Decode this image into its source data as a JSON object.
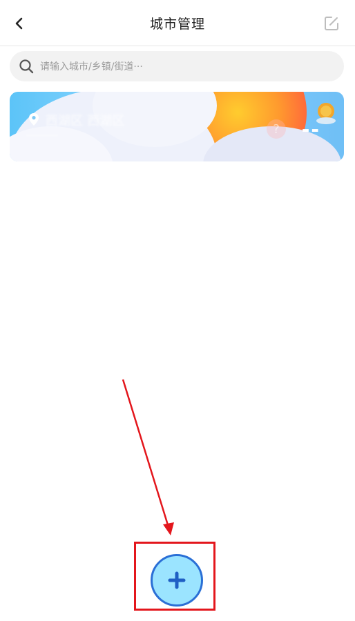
{
  "header": {
    "title": "城市管理",
    "back_icon": "chevron-left-icon",
    "edit_icon": "edit-icon"
  },
  "search": {
    "placeholder": "请输入城市/乡镇/街道···",
    "icon": "search-icon"
  },
  "city_card": {
    "location_icon": "location-pin-icon",
    "name": "西湖区 西湖区",
    "temperature": "--",
    "weather_icon": "sun-cloud-icon"
  },
  "add_button": {
    "icon": "plus-icon"
  },
  "colors": {
    "accent_blue": "#2a6fd6",
    "add_button_fill": "#9be4ff",
    "highlight_red": "#e3161c"
  }
}
